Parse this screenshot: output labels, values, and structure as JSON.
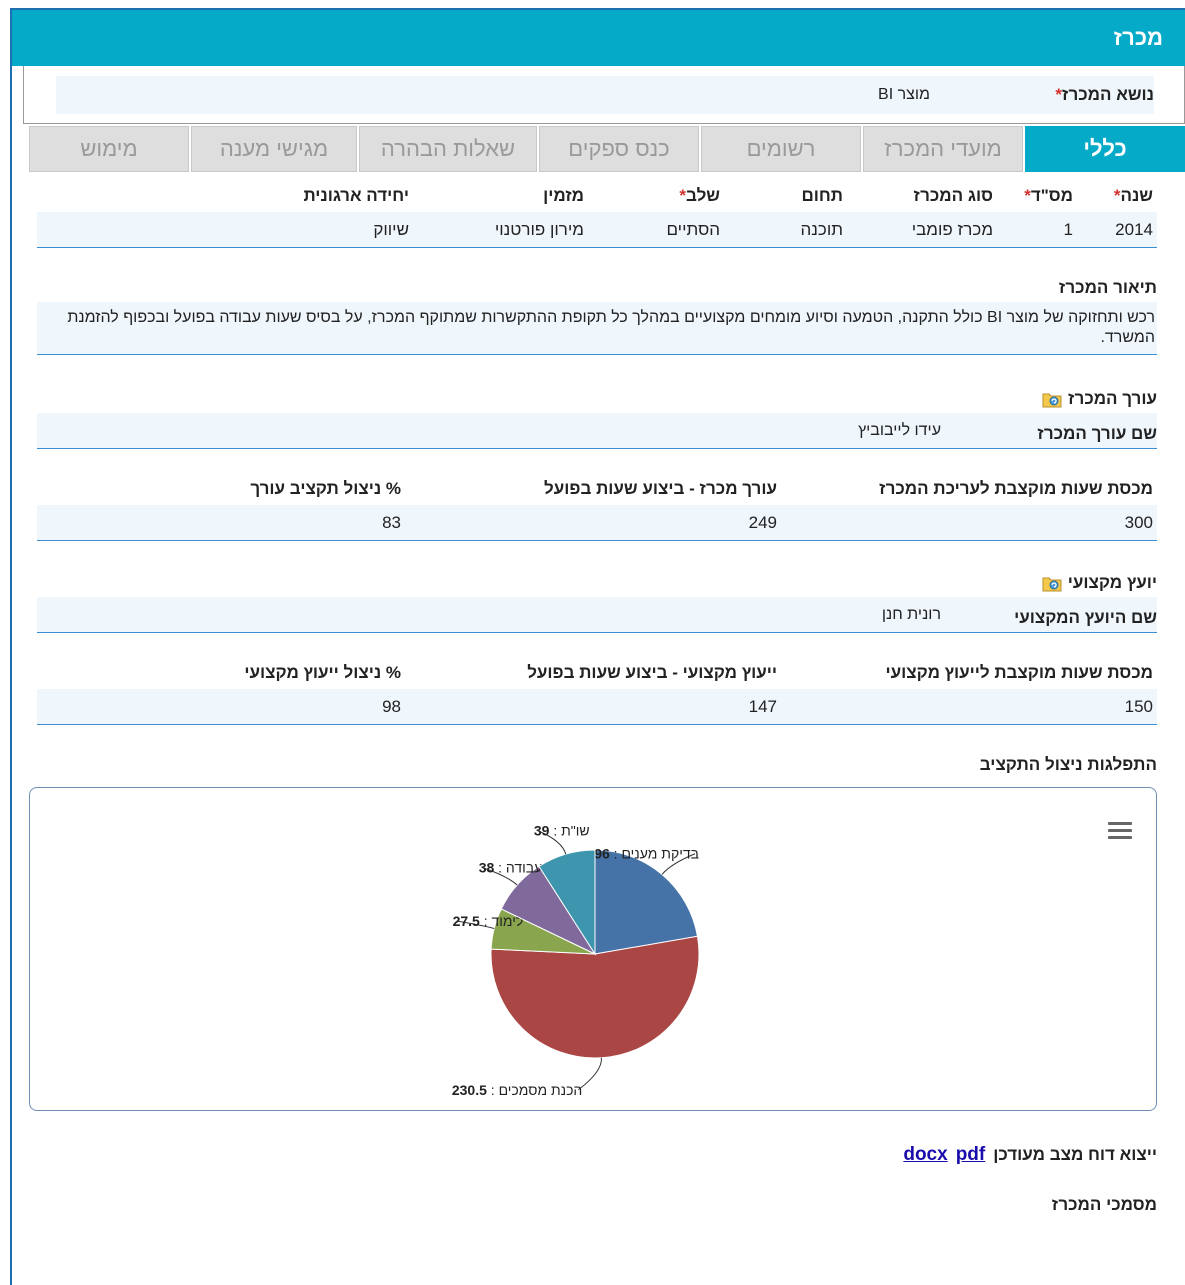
{
  "window": {
    "title": "מכרז"
  },
  "subject": {
    "label": "נושא המכרז",
    "required": "*",
    "value": "מוצר BI"
  },
  "tabs": [
    {
      "label": "כללי",
      "active": true
    },
    {
      "label": "מועדי המכרז",
      "active": false
    },
    {
      "label": "רשומים",
      "active": false
    },
    {
      "label": "כנס ספקים",
      "active": false
    },
    {
      "label": "שאלות הבהרה",
      "active": false
    },
    {
      "label": "מגישי מענה",
      "active": false
    },
    {
      "label": "מימוש",
      "active": false
    }
  ],
  "general": {
    "headers": {
      "year": "שנה",
      "num": "מס\"ד",
      "type": "סוג המכרז",
      "field": "תחום",
      "stage": "שלב",
      "orderer": "מזמין",
      "unit": "יחידה ארגונית"
    },
    "req": "*",
    "row": {
      "year": "2014",
      "num": "1",
      "type": "מכרז פומבי",
      "field": "תוכנה",
      "stage": "הסתיים",
      "orderer": "מירון פורטנוי",
      "unit": "שיווק"
    }
  },
  "description": {
    "title": "תיאור המכרז",
    "text": "רכש ותחזוקה של מוצר BI כולל התקנה, הטמעה וסיוע מומחים מקצועיים במהלך כל תקופת ההתקשרות שמתוקף המכרז, על בסיס שעות עבודה בפועל ובכפוף להזמנת המשרד."
  },
  "editor": {
    "title": "עורך המכרז",
    "name_label": "שם עורך המכרז",
    "name_value": "עידו לייבוביץ",
    "headers": {
      "quota": "מכסת שעות מוקצבת לעריכת המכרז",
      "actual": "עורך מכרז - ביצוע שעות בפועל",
      "pct": "% ניצול תקציב עורך"
    },
    "values": {
      "quota": "300",
      "actual": "249",
      "pct": "83"
    }
  },
  "consultant": {
    "title": "יועץ מקצועי",
    "name_label": "שם היועץ המקצועי",
    "name_value": "רונית חנן",
    "headers": {
      "quota": "מכסת שעות מוקצבת לייעוץ מקצועי",
      "actual": "ייעוץ מקצועי - ביצוע שעות בפועל",
      "pct": "% ניצול ייעוץ מקצועי"
    },
    "values": {
      "quota": "150",
      "actual": "147",
      "pct": "98"
    }
  },
  "chart_section": {
    "title": "התפלגות ניצול התקציב"
  },
  "chart_data": {
    "type": "pie",
    "slices": [
      {
        "label": "בדיקת מענים",
        "value": 96,
        "color": "#4572a7"
      },
      {
        "label": "הכנת מסמכים",
        "value": 230.5,
        "color": "#aa4643"
      },
      {
        "label": "לימוד",
        "value": 27.5,
        "color": "#89a54e"
      },
      {
        "label": "פגישת עבודה",
        "value": 38,
        "color": "#80699b"
      },
      {
        "label": "שו\"ת",
        "value": 39,
        "color": "#3d96ae"
      }
    ]
  },
  "export": {
    "label": "ייצוא דוח מצב מעודכן",
    "pdf": "pdf",
    "docx": "docx"
  },
  "documents": {
    "title": "מסמכי המכרז"
  },
  "colors": {
    "accent": "#05aac8",
    "link": "#1a0dab",
    "row_bg": "#f0f7fc",
    "row_border": "#3a8fd4"
  }
}
